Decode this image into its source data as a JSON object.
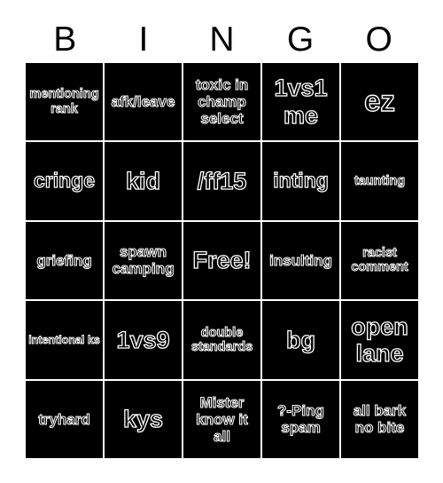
{
  "card": {
    "title": "BINGO",
    "background_color": "#ffffff",
    "cell_color": "#000000",
    "text_outline_color": "#ffffff",
    "header_text_color": "#000000",
    "columns": 5,
    "rows": 5
  },
  "header": {
    "letters": [
      "B",
      "I",
      "N",
      "G",
      "O"
    ]
  },
  "grid": {
    "cells": [
      {
        "text": "mentioning rank",
        "size": "fs-sm"
      },
      {
        "text": "afk/leave",
        "size": "fs-md"
      },
      {
        "text": "toxic in champ select",
        "size": "fs-md"
      },
      {
        "text": "1vs1 me",
        "size": "fs-xl"
      },
      {
        "text": "ez",
        "size": "fs-xxl"
      },
      {
        "text": "cringe",
        "size": "fs-lg"
      },
      {
        "text": "kid",
        "size": "fs-xl"
      },
      {
        "text": "/ff15",
        "size": "fs-xl"
      },
      {
        "text": "inting",
        "size": "fs-lg"
      },
      {
        "text": "taunting",
        "size": "fs-sm"
      },
      {
        "text": "griefing",
        "size": "fs-md"
      },
      {
        "text": "spawn camping",
        "size": "fs-md"
      },
      {
        "text": "Free!",
        "size": "fs-xl"
      },
      {
        "text": "insulting",
        "size": "fs-md"
      },
      {
        "text": "racist comment",
        "size": "fs-sm"
      },
      {
        "text": "intentional ks",
        "size": "fs-xs"
      },
      {
        "text": "1vs9",
        "size": "fs-xl"
      },
      {
        "text": "double standards",
        "size": "fs-sm"
      },
      {
        "text": "bg",
        "size": "fs-xl"
      },
      {
        "text": "open lane",
        "size": "fs-xl"
      },
      {
        "text": "tryhard",
        "size": "fs-md"
      },
      {
        "text": "kys",
        "size": "fs-xl"
      },
      {
        "text": "Mister know it all",
        "size": "fs-md"
      },
      {
        "text": "?-Ping spam",
        "size": "fs-md"
      },
      {
        "text": "all bark no bite",
        "size": "fs-md"
      }
    ]
  }
}
